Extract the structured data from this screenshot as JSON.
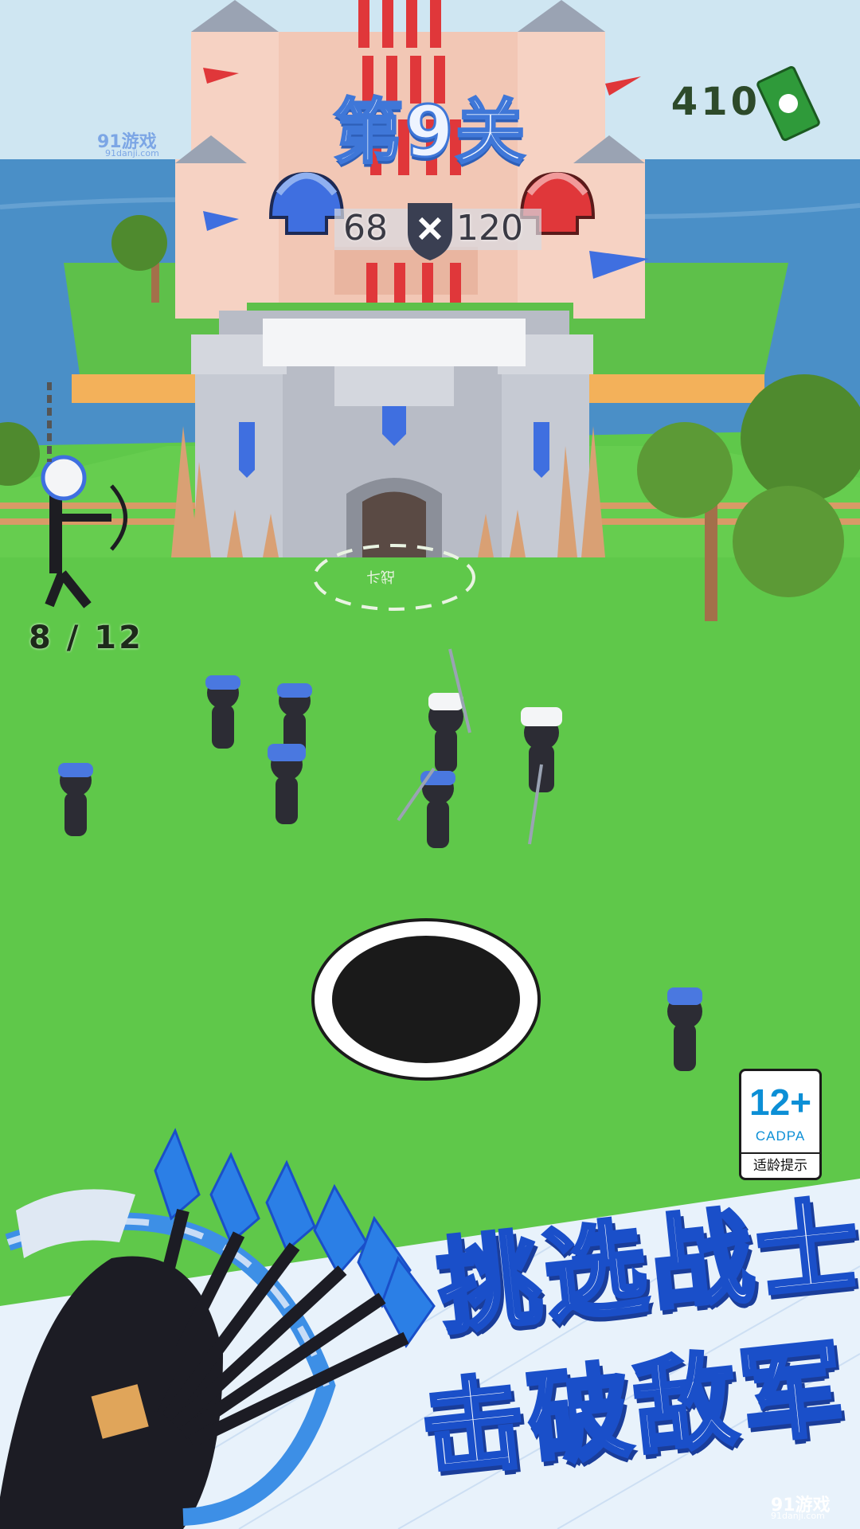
{
  "hud": {
    "level_title": "第9关",
    "coins": "410",
    "blue_army_count": "68",
    "red_army_count": "120",
    "troop_capacity": "8 / 12"
  },
  "ground_label": "战斗",
  "age_rating": {
    "age": "12+",
    "org": "CADPA",
    "label": "适龄提示"
  },
  "promo": {
    "line1": "挑选战士",
    "line2": "击破敌军"
  },
  "watermark": {
    "name": "91游戏",
    "domain": "91danji.com"
  },
  "icons": {
    "blue_helmet": "blue-helmet-icon",
    "red_helmet": "red-helmet-icon",
    "battle": "crossed-swords-shield-icon",
    "cash": "cash-bill-icon",
    "archer": "archer-unit-icon"
  },
  "colors": {
    "grass": "#5fc84a",
    "sea": "#4a8fc7",
    "blue_team": "#3f6fe0",
    "red_team": "#e0373a",
    "accent_text_stroke": "#1a4fc9"
  }
}
